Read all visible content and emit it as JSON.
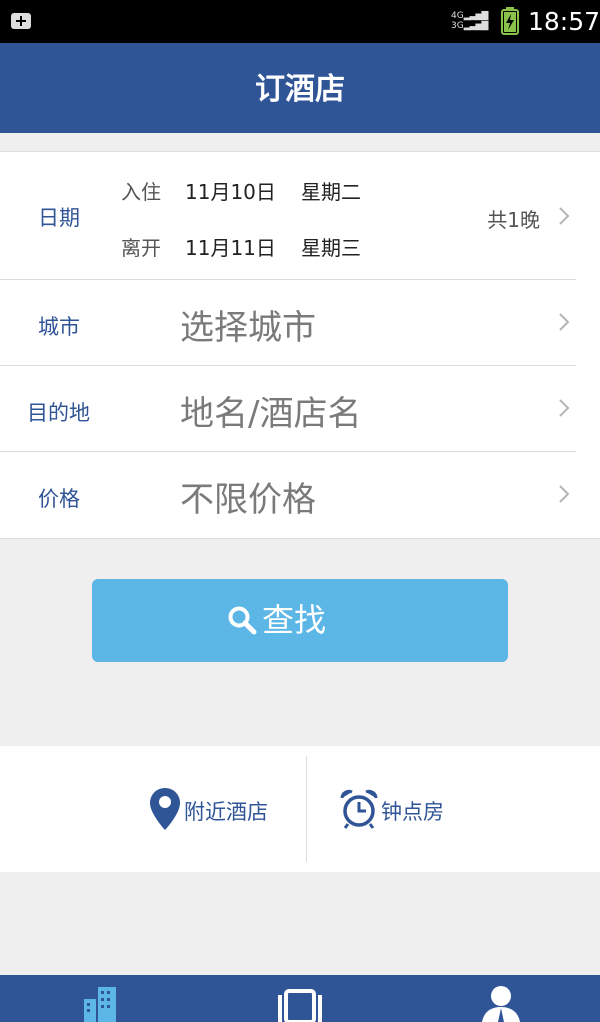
{
  "status_bar": {
    "time": "18:57",
    "network_top": "4G",
    "network_bottom": "3G"
  },
  "header": {
    "title": "订酒店"
  },
  "form": {
    "date": {
      "label": "日期",
      "checkin_label": "入住",
      "checkin_date": "11月10日",
      "checkin_weekday": "星期二",
      "checkout_label": "离开",
      "checkout_date": "11月11日",
      "checkout_weekday": "星期三",
      "nights": "共1晚"
    },
    "city": {
      "label": "城市",
      "placeholder": "选择城市"
    },
    "destination": {
      "label": "目的地",
      "placeholder": "地名/酒店名"
    },
    "price": {
      "label": "价格",
      "placeholder": "不限价格"
    }
  },
  "search_button": {
    "label": "查找",
    "icon": "search-icon"
  },
  "quick_links": [
    {
      "label": "附近酒店",
      "icon": "location-pin-icon"
    },
    {
      "label": "钟点房",
      "icon": "alarm-clock-icon"
    }
  ],
  "tabbar": {
    "tabs": [
      {
        "icon": "hotel-building-icon"
      },
      {
        "icon": "orders-icon"
      },
      {
        "icon": "user-icon"
      }
    ]
  },
  "colors": {
    "brand": "#2f5597",
    "search_button": "#5cb7e6",
    "label": "#2f5597"
  }
}
